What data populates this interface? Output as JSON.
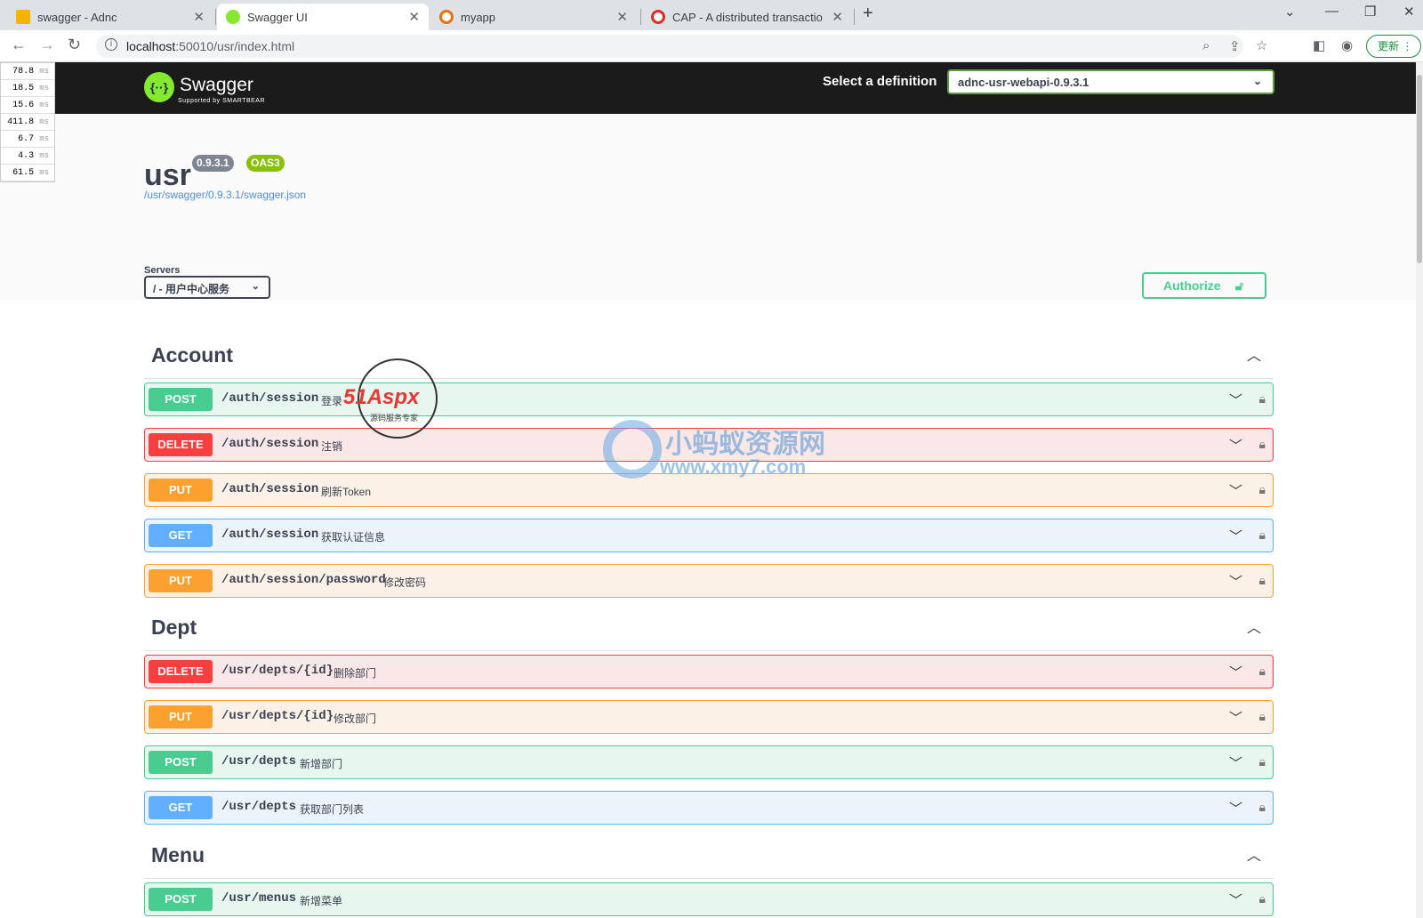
{
  "browser": {
    "tabs": [
      {
        "label": "swagger - Adnc",
        "active": false
      },
      {
        "label": "Swagger UI",
        "active": true
      },
      {
        "label": "myapp",
        "active": false
      },
      {
        "label": "CAP - A distributed transactio",
        "active": false
      }
    ],
    "address": {
      "host": "localhost",
      "rest": ":50010/usr/index.html"
    },
    "update_label": "更新"
  },
  "profiler": {
    "timings": [
      "78.8",
      "18.5",
      "15.6",
      "411.8",
      "6.7",
      "4.3",
      "61.5"
    ],
    "unit": "ms"
  },
  "swagger": {
    "brand": "Swagger",
    "brand_sub": "Supported by SMARTBEAR",
    "definition_label": "Select a definition",
    "definition_value": "adnc-usr-webapi-0.9.3.1",
    "title": "usr",
    "version": "0.9.3.1",
    "oas": "OAS3",
    "spec_url": "/usr/swagger/0.9.3.1/swagger.json",
    "servers_label": "Servers",
    "server_value": "/ - 用户中心服务",
    "authorize_label": "Authorize"
  },
  "tags": [
    {
      "name": "Account",
      "ops": [
        {
          "method": "POST",
          "path": "/auth/session",
          "summary": "登录"
        },
        {
          "method": "DELETE",
          "path": "/auth/session",
          "summary": "注销"
        },
        {
          "method": "PUT",
          "path": "/auth/session",
          "summary": "刷新Token"
        },
        {
          "method": "GET",
          "path": "/auth/session",
          "summary": "获取认证信息"
        },
        {
          "method": "PUT",
          "path": "/auth/session/password",
          "summary": "修改密码"
        }
      ]
    },
    {
      "name": "Dept",
      "ops": [
        {
          "method": "DELETE",
          "path": "/usr/depts/{id}",
          "summary": "删除部门"
        },
        {
          "method": "PUT",
          "path": "/usr/depts/{id}",
          "summary": "修改部门"
        },
        {
          "method": "POST",
          "path": "/usr/depts",
          "summary": "新增部门"
        },
        {
          "method": "GET",
          "path": "/usr/depts",
          "summary": "获取部门列表"
        }
      ]
    },
    {
      "name": "Menu",
      "ops": [
        {
          "method": "POST",
          "path": "/usr/menus",
          "summary": "新增菜单"
        }
      ]
    }
  ],
  "watermarks": {
    "logo1": "51Aspx",
    "logo1_sub": "源码服务专家",
    "logo2": "小蚂蚁资源网",
    "logo2_url": "www.xmy7.com"
  },
  "colors": {
    "post": "#49cc90",
    "delete": "#f93e3e",
    "put": "#fca130",
    "get": "#61affe",
    "topbar": "#1b1b1b",
    "swagger_green": "#85ea2d"
  },
  "icons": [
    "back-arrow-icon",
    "forward-arrow-icon",
    "reload-icon",
    "info-icon",
    "zoom-icon",
    "share-icon",
    "star-icon",
    "sidepanel-icon",
    "profile-icon",
    "chevron-down-icon",
    "chevron-up-icon",
    "lock-icon"
  ]
}
